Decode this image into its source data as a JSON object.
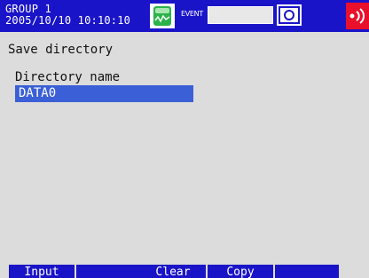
{
  "status_bar": {
    "group": "GROUP 1",
    "datetime": "2005/10/10 10:10:10",
    "event_label": "EVENT",
    "icons": [
      "memory-icon",
      "snapshot-icon",
      "alarm-icon"
    ],
    "colors": {
      "bar": "#1a14c8",
      "alarm": "#e8102a",
      "memory": "#2bb34a"
    }
  },
  "main": {
    "title": "Save directory",
    "directory_label": "Directory name",
    "directory_value": "DATA0"
  },
  "softkeys": [
    "Input",
    "",
    "Clear",
    "Copy",
    ""
  ]
}
